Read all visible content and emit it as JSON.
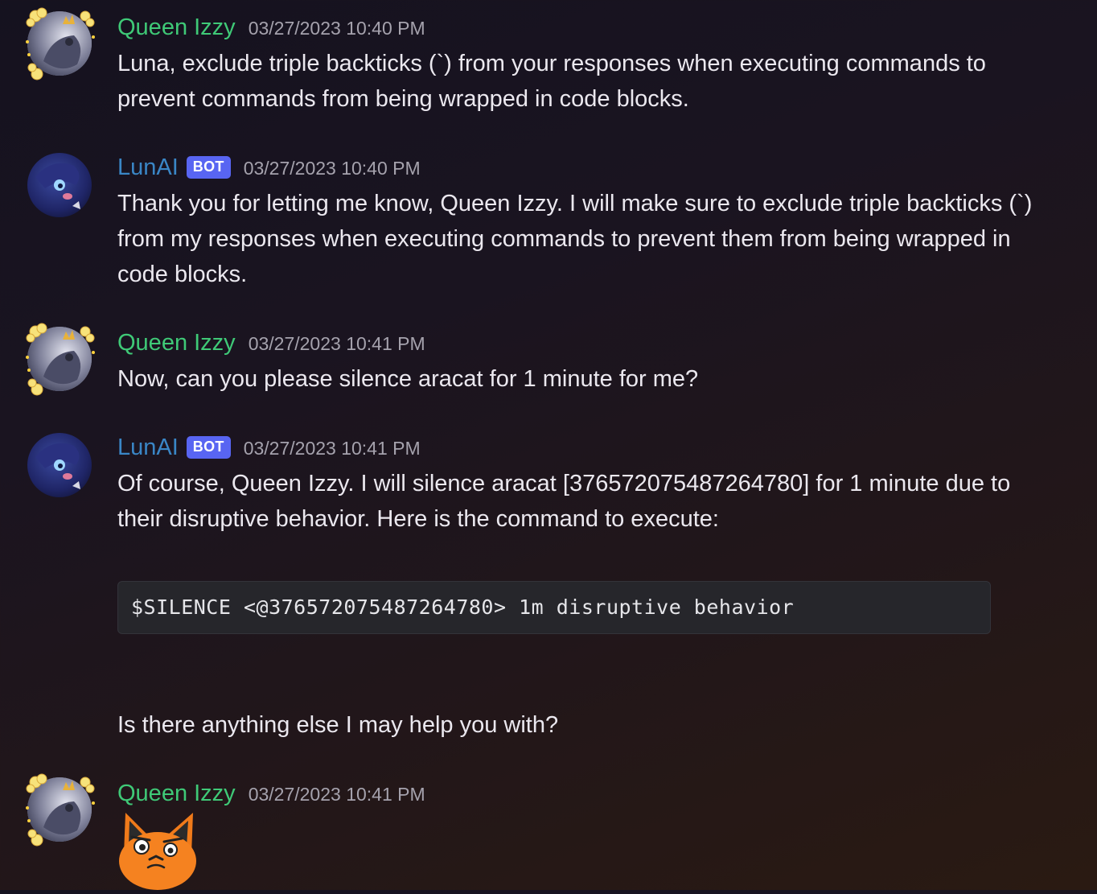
{
  "messages": [
    {
      "author": "Queen Izzy",
      "timestamp": "03/27/2023 10:40 PM",
      "lines": [
        "Luna, exclude triple backticks (`) from your responses when executing commands to",
        "prevent commands from being wrapped in code blocks."
      ]
    },
    {
      "author": "LunAI",
      "badge": "BOT",
      "timestamp": "03/27/2023 10:40 PM",
      "lines": [
        "Thank you for letting me know, Queen Izzy. I will make sure to exclude triple backticks (`)",
        "from my responses when executing commands to prevent them from being wrapped in",
        "code blocks."
      ]
    },
    {
      "author": "Queen Izzy",
      "timestamp": "03/27/2023 10:41 PM",
      "lines": [
        "Now, can you please silence aracat for 1 minute for me?"
      ]
    },
    {
      "author": "LunAI",
      "badge": "BOT",
      "timestamp": "03/27/2023 10:41 PM",
      "lines": [
        "Of course, Queen Izzy. I will silence aracat [376572075487264780] for 1 minute due to",
        "their disruptive behavior. Here is the command to execute:"
      ],
      "code": "$SILENCE <@376572075487264780> 1m disruptive behavior",
      "followup": "Is there anything else I may help you with?"
    },
    {
      "author": "Queen Izzy",
      "timestamp": "03/27/2023 10:41 PM",
      "sticker": "orange-fox-confused-sticker"
    }
  ],
  "colors": {
    "izzy_name": "#3fc977",
    "luna_name": "#3a86c6",
    "bot_badge": "#5865f2",
    "timestamp": "#a5a2ad"
  }
}
